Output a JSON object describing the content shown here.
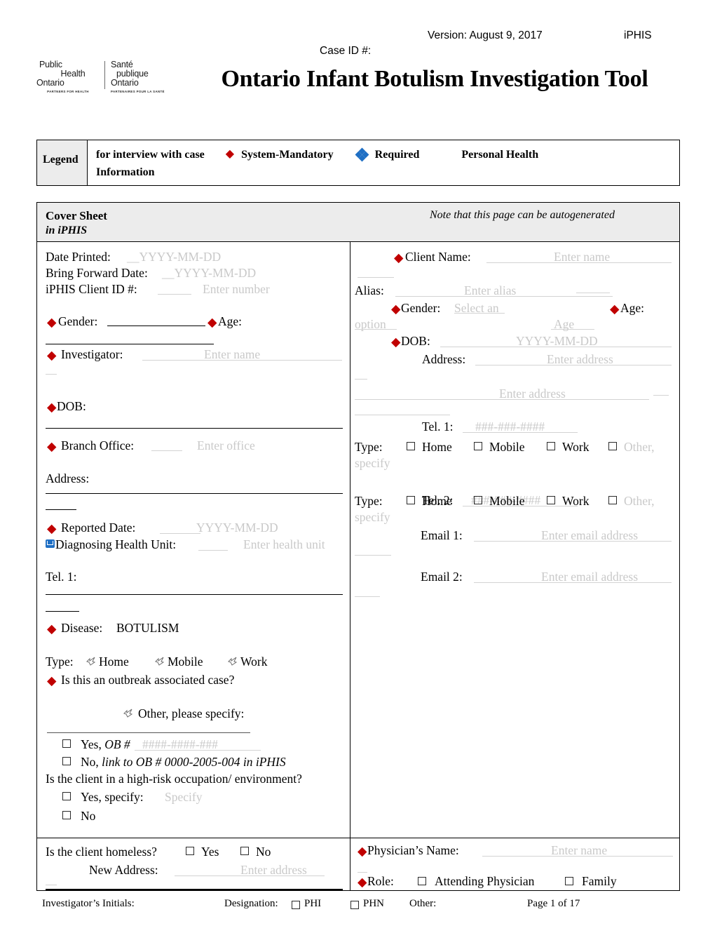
{
  "header": {
    "version": "Version: August 9, 2017",
    "system": "iPHIS",
    "case_id": "Case ID #:",
    "title": "Ontario Infant Botulism Investigation Tool",
    "logo": {
      "en_line1": "Public",
      "en_line2": "Health",
      "en_line3": "Ontario",
      "en_tagline": "PARTNERS FOR HEALTH",
      "fr_line1": "Santé",
      "fr_line2": "publique",
      "fr_line3": "Ontario",
      "fr_tagline": "PARTENAIRES POUR LA SANTÉ"
    }
  },
  "legend": {
    "label": "Legend",
    "text_interview": "for interview with case",
    "system_mandatory": "System-Mandatory",
    "required": "Required",
    "personal_health_info": "Personal Health Information",
    "red_marker_color": "#C00000",
    "blue_marker_color": "#1F6FC4"
  },
  "cover_sheet": {
    "title": "Cover Sheet",
    "note": "Note that this page can be autogenerated",
    "note_continued": "in iPHIS"
  },
  "left_column": {
    "date_printed_label": "Date Printed:",
    "date_printed_value": "__YYYY-MM-DD",
    "bring_forward_label": "Bring Forward Date:",
    "bring_forward_value": "__YYYY-MM-DD",
    "iphis_client_id_label": "iPHIS Client ID #:",
    "iphis_client_id_value": "Enter number",
    "gender_label": "Gender:",
    "age_label": "Age:",
    "investigator_label": "Investigator:",
    "investigator_value": "Enter name",
    "dob_label": "DOB:",
    "branch_office_label": "Branch Office:",
    "branch_office_value": "Enter office",
    "address_label": "Address:",
    "reported_date_label": "Reported Date:",
    "reported_date_value": "YYYY-MM-DD",
    "diagnosing_health_unit_label": "Diagnosing Health Unit:",
    "diagnosing_health_unit_value": "Enter health unit",
    "tel1_label": "Tel. 1:",
    "disease_label": "Disease:",
    "disease_value": "BOTULISM",
    "type_label": "Type:",
    "type_home": "Home",
    "type_mobile": "Mobile",
    "type_work": "Work",
    "outbreak_question": "Is this an outbreak associated case?",
    "other_specify": "Other, please specify:",
    "ob_yes_label": "Yes,",
    "ob_yes_italic": "OB #",
    "ob_yes_value": "####-####-###",
    "ob_no_label": "No,",
    "ob_no_italic": "link to OB # 0000-2005-004 in iPHIS",
    "high_risk_question": "Is the client in a high-risk occupation/ environment?",
    "high_risk_yes": "Yes, specify:",
    "high_risk_yes_value": "Specify",
    "high_risk_no": "No"
  },
  "right_column": {
    "client_name_label": "Client Name:",
    "client_name_value": "Enter name",
    "alias_label": "Alias:",
    "alias_value": "Enter alias",
    "gender_label": "Gender:",
    "gender_value": "Select an option",
    "gender_value_line1": "Select an",
    "gender_value_line2": "option",
    "age_label": "Age:",
    "age_value": "Age",
    "dob_label": "DOB:",
    "dob_value": "YYYY-MM-DD",
    "address_label": "Address:",
    "address_value_1": "Enter address",
    "address_value_2": "Enter address",
    "tel1_label": "Tel. 1:",
    "tel1_value": "###-###-####",
    "tel1_type_label": "Type:",
    "tel2_label": "Tel. 2:",
    "tel2_value": "###-###-####",
    "tel2_type_label": "Type:",
    "type_home": "Home",
    "type_mobile": "Mobile",
    "type_work": "Work",
    "type_other": "Other, specify",
    "type_other_line1": "Other,",
    "type_other_line2": "specify",
    "email1_label": "Email 1:",
    "email1_value": "Enter email address",
    "email2_label": "Email 2:",
    "email2_value": "Enter email address"
  },
  "bottom_row": {
    "homeless_question": "Is the client homeless?",
    "homeless_yes": "Yes",
    "homeless_no": "No",
    "new_address_label": "New Address:",
    "new_address_value": "Enter address",
    "physician_name_label": "Physician’s Name:",
    "physician_name_value": "Enter name",
    "role_label": "Role:",
    "role_attending": "Attending Physician",
    "role_family": "Family"
  },
  "footer": {
    "initials_label": "Investigator’s Initials:",
    "designation_label": "Designation:",
    "designation_phi": "PHI",
    "designation_phn": "PHN",
    "other_label": "Other:",
    "page_label": "Page 1 of 17"
  }
}
